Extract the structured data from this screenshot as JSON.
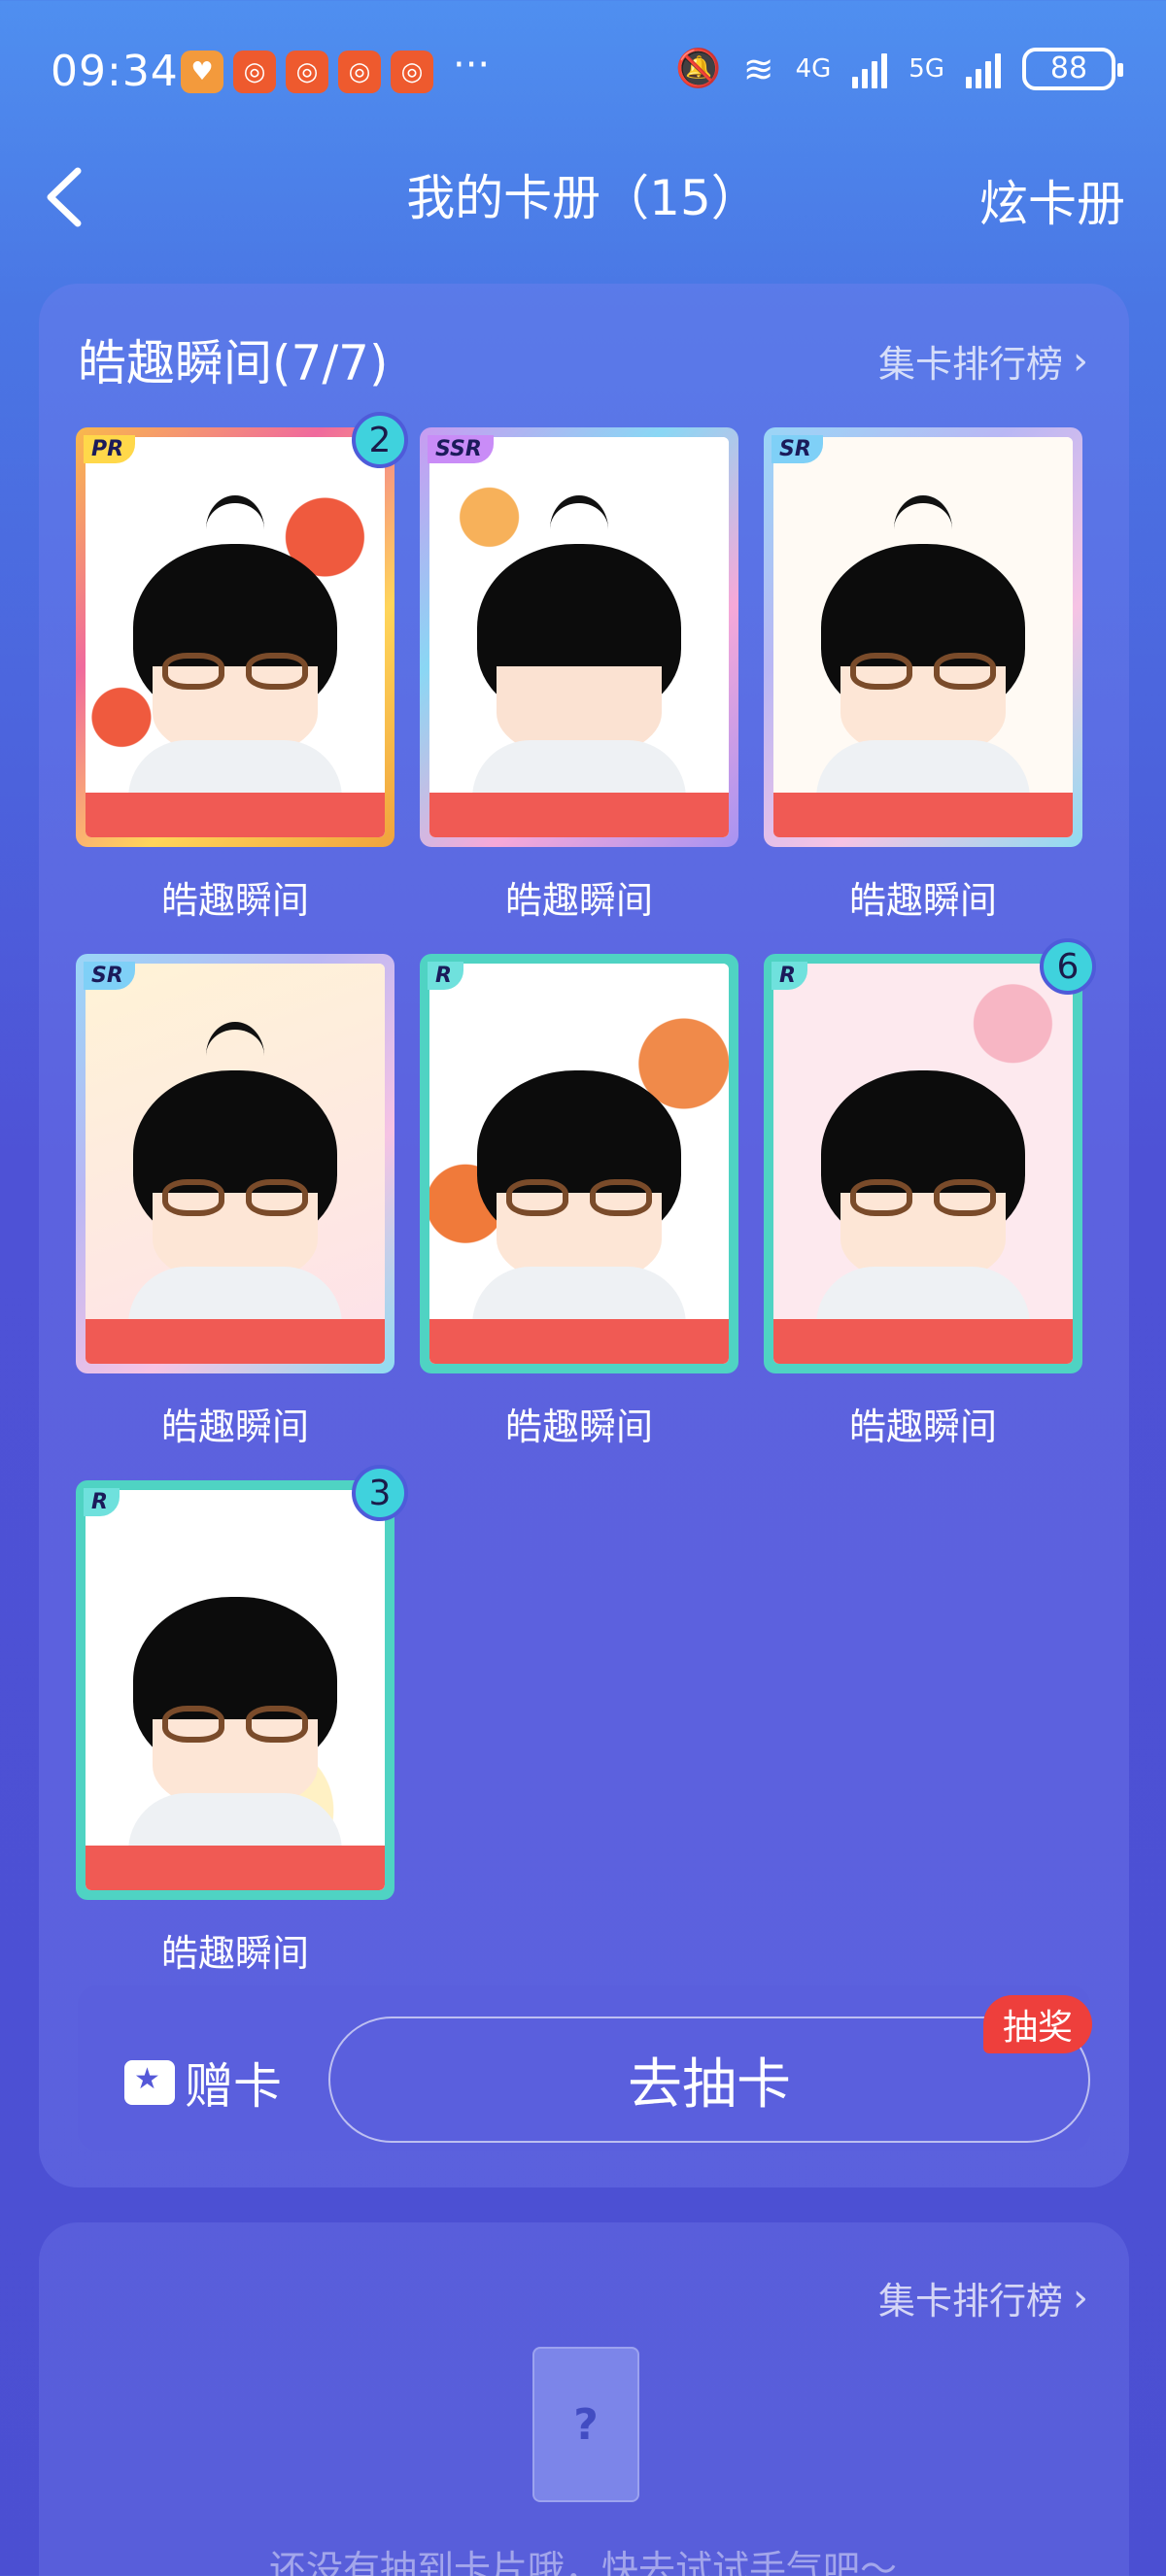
{
  "status_bar": {
    "time": "09:34",
    "overflow": "···",
    "net1": "4G",
    "net2": "5G",
    "battery": "88"
  },
  "nav": {
    "title": "我的卡册（15）",
    "right": "炫卡册"
  },
  "album": {
    "title": "皓趣瞬间(7/7)",
    "rank_link": "集卡排行榜",
    "cards": [
      {
        "rarity": "PR",
        "name": "皓趣瞬间",
        "count": "2"
      },
      {
        "rarity": "SSR",
        "name": "皓趣瞬间",
        "count": ""
      },
      {
        "rarity": "SR",
        "name": "皓趣瞬间",
        "count": ""
      },
      {
        "rarity": "SR",
        "name": "皓趣瞬间",
        "count": ""
      },
      {
        "rarity": "R",
        "name": "皓趣瞬间",
        "count": ""
      },
      {
        "rarity": "R",
        "name": "皓趣瞬间",
        "count": "6"
      },
      {
        "rarity": "R",
        "name": "皓趣瞬间",
        "count": "3"
      }
    ]
  },
  "actions": {
    "gift": "赠卡",
    "draw": "去抽卡",
    "lottery_tag": "抽奖"
  },
  "second_album": {
    "rank_link": "集卡排行榜",
    "placeholder_mark": "?",
    "empty_text": "还没有抽到卡片哦，快去试试手气吧～"
  }
}
